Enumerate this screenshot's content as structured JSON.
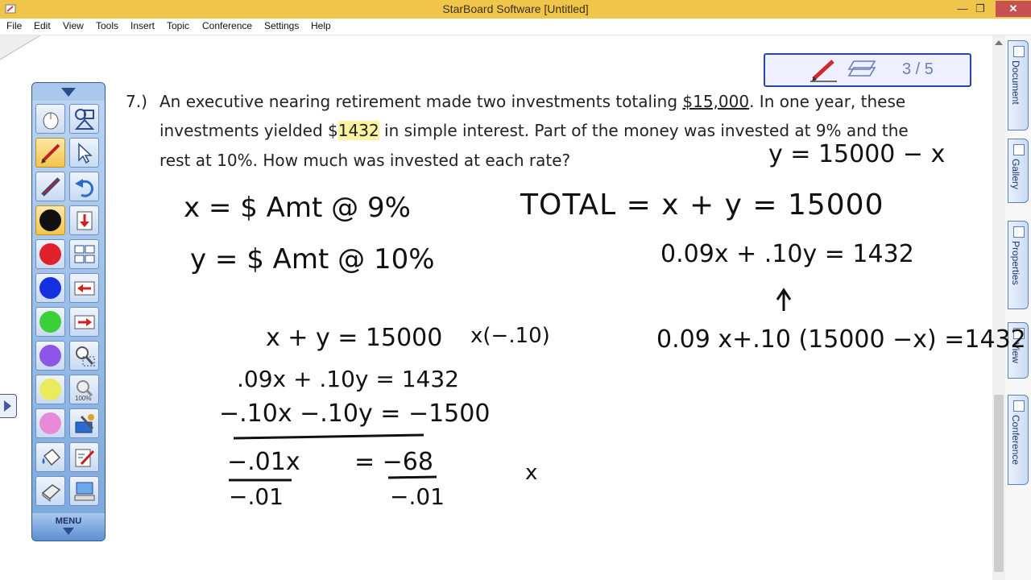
{
  "window": {
    "title": "StarBoard Software [Untitled]",
    "min_glyph": "—",
    "max_glyph": "❐",
    "close_glyph": "✕"
  },
  "menu": [
    "File",
    "Edit",
    "View",
    "Tools",
    "Insert",
    "Topic",
    "Conference",
    "Settings",
    "Help"
  ],
  "page_indicator": {
    "text": "3 / 5",
    "pen_icon": "pen-icon",
    "eraser_icon": "eraser-icon"
  },
  "toolbox": {
    "menu_label": "MENU",
    "colors": {
      "black": "#111111",
      "red": "#e0202a",
      "blue": "#1530e0",
      "green": "#3ad03a",
      "purple": "#8d55e8",
      "yellow": "#e9ea5c",
      "pink": "#e88ad8"
    },
    "zoom_label": "100%"
  },
  "side_tabs": [
    "Document",
    "Gallery",
    "Properties",
    "View",
    "Conference"
  ],
  "problem": {
    "number": "7.)",
    "line1_a": "An executive nearing retirement made two investments totaling ",
    "line1_amount": "$15,000",
    "line1_b": ".  In one year, these",
    "line2_a": "investments yielded ",
    "line2_dollar": "$",
    "line2_amount": "1432",
    "line2_b": " in simple interest.  Part of the money was invested at 9% and the",
    "line3": "rest at 10%.  How much was invested at each rate?"
  },
  "handwriting": {
    "x_def": "x = $ Amt @ 9%",
    "y_def": "y = $ Amt @ 10%",
    "total": "TOTAL  =  x + y  =  15000",
    "interest": "0.09x + .10y  =  1432",
    "y_sub": "y = 15000 − x",
    "substituted": "0.09 x+.10 (15000 −x) =1432",
    "eq1": "x + y  =  15000",
    "mult": "x(−.10)",
    "eq2": ".09x + .10y = 1432",
    "eq3": "−.10x −.10y = −1500",
    "res_left": "−.01x",
    "res_right": "= −68",
    "div_left": "−.01",
    "div_right": "−.01",
    "stray_x": "x"
  }
}
